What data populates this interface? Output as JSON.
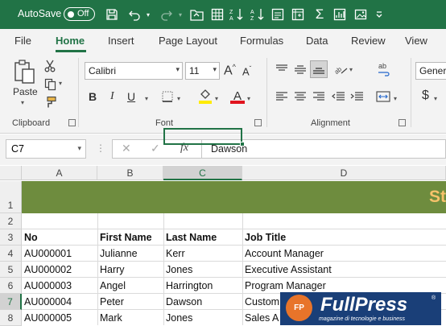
{
  "titlebar": {
    "autosave_label": "AutoSave",
    "autosave_state": "Off"
  },
  "tabs": [
    "File",
    "Home",
    "Insert",
    "Page Layout",
    "Formulas",
    "Data",
    "Review",
    "View"
  ],
  "ribbon": {
    "clipboard": {
      "paste_label": "Paste",
      "group_label": "Clipboard"
    },
    "font": {
      "name": "Calibri",
      "size": "11",
      "group_label": "Font",
      "grow_label": "A",
      "shrink_label": "A",
      "bold": "B",
      "italic": "I",
      "underline": "U",
      "font_color_label": "A"
    },
    "alignment": {
      "group_label": "Alignment"
    },
    "number": {
      "format": "Gener"
    }
  },
  "formula_bar": {
    "name_box": "C7",
    "fx_label": "fx",
    "content": "Dawson"
  },
  "grid": {
    "columns": [
      "A",
      "B",
      "C",
      "D"
    ],
    "selected_column": "C",
    "rows": [
      "1",
      "2",
      "3",
      "4",
      "5",
      "6",
      "7",
      "8"
    ],
    "selected_row": "7",
    "banner_text": "St",
    "header": [
      "No",
      "First Name",
      "Last Name",
      "Job Title"
    ],
    "data": [
      [
        "AU000001",
        "Julianne",
        "Kerr",
        "Account Manager"
      ],
      [
        "AU000002",
        "Harry",
        "Jones",
        "Executive Assistant"
      ],
      [
        "AU000003",
        "Angel",
        "Harrington",
        "Program Manager"
      ],
      [
        "AU000004",
        "Peter",
        "Dawson",
        "Custom"
      ],
      [
        "AU000005",
        "Mark",
        "Jones",
        "Sales A"
      ]
    ]
  },
  "watermark": {
    "logo_text": "FP",
    "name": "FullPress",
    "registered": "®",
    "tagline": "magazine di tecnologie e business"
  },
  "colors": {
    "accent": "#217346",
    "banner": "#6e8c3e",
    "banner_text": "#f6c26a",
    "watermark_bg": "#1a3f78"
  }
}
